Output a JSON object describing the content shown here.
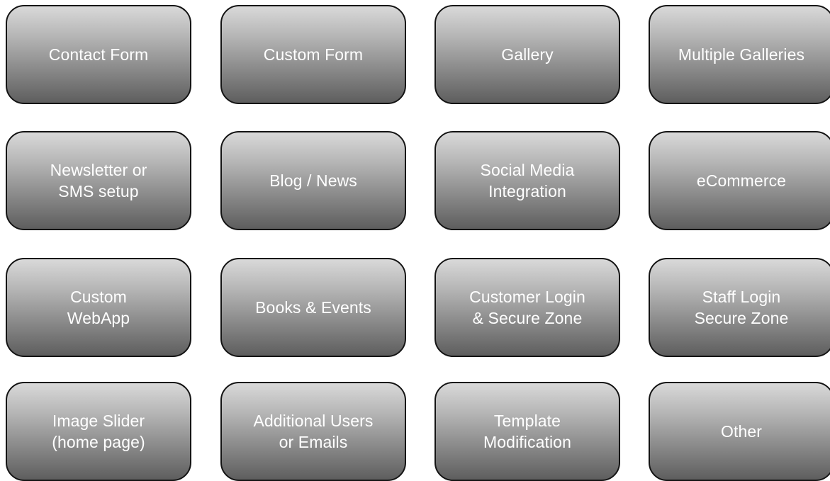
{
  "tiles": [
    {
      "label": "Contact Form"
    },
    {
      "label": "Custom Form"
    },
    {
      "label": "Gallery"
    },
    {
      "label": "Multiple Galleries"
    },
    {
      "label": "Newsletter or\nSMS setup"
    },
    {
      "label": "Blog / News"
    },
    {
      "label": "Social Media\nIntegration"
    },
    {
      "label": "eCommerce"
    },
    {
      "label": "Custom\nWebApp"
    },
    {
      "label": "Books & Events"
    },
    {
      "label": "Customer Login\n& Secure Zone"
    },
    {
      "label": "Staff Login\nSecure Zone"
    },
    {
      "label": "Image Slider\n(home page)"
    },
    {
      "label": "Additional Users\nor Emails"
    },
    {
      "label": "Template\nModification"
    },
    {
      "label": "Other"
    }
  ]
}
